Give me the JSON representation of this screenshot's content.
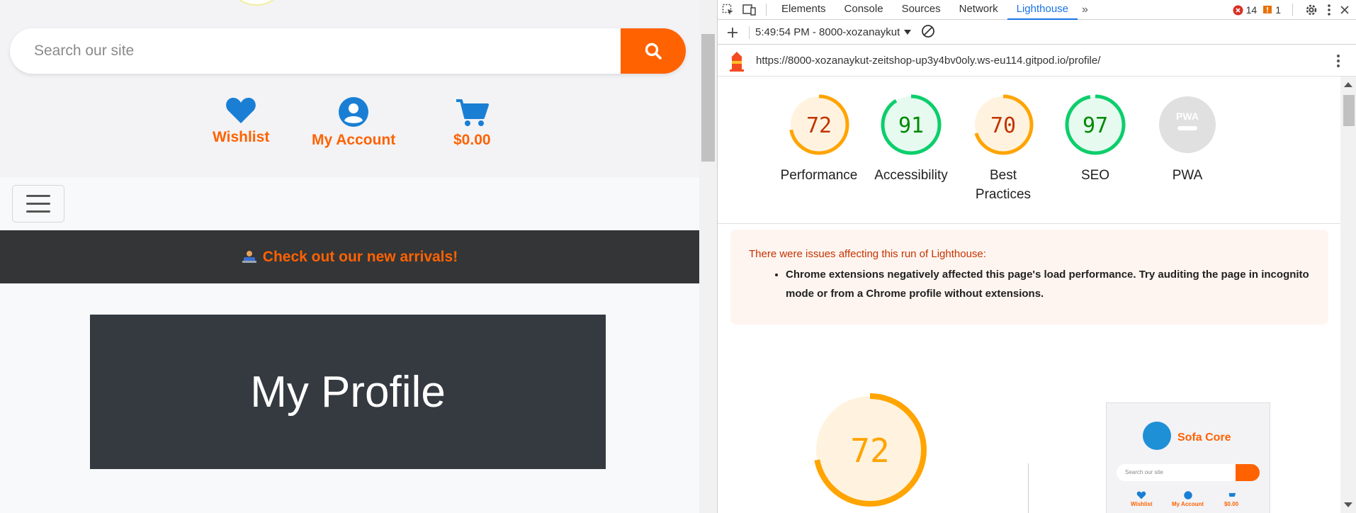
{
  "site": {
    "search": {
      "placeholder": "Search our site"
    },
    "header_links": {
      "wishlist": "Wishlist",
      "account": "My Account",
      "cart": "$0.00"
    },
    "promo": {
      "text": "Check out our new arrivals!"
    },
    "hero": {
      "title": "My Profile"
    }
  },
  "devtools": {
    "tabs": [
      "Elements",
      "Console",
      "Sources",
      "Network",
      "Lighthouse"
    ],
    "active_tab": "Lighthouse",
    "errors_count": "14",
    "warnings_count": "1",
    "report_label": "5:49:54 PM - 8000-xozanaykut",
    "url": "https://8000-xozanaykut-zeitshop-up3y4bv0oly.ws-eu114.gitpod.io/profile/"
  },
  "lighthouse": {
    "categories": [
      {
        "name": "Performance",
        "score": "72",
        "fraction": 0.72,
        "color": "#ffa400",
        "bg": "#fff3e0",
        "text_color": "#c33300"
      },
      {
        "name": "Accessibility",
        "score": "91",
        "fraction": 0.91,
        "color": "#0cce6b",
        "bg": "#e6faf0",
        "text_color": "#008800"
      },
      {
        "name": "Best Practices",
        "score": "70",
        "fraction": 0.7,
        "color": "#ffa400",
        "bg": "#fff3e0",
        "text_color": "#c33300"
      },
      {
        "name": "SEO",
        "score": "97",
        "fraction": 0.97,
        "color": "#0cce6b",
        "bg": "#e6faf0",
        "text_color": "#008800"
      },
      {
        "name": "PWA",
        "score": "PWA",
        "fraction": 0,
        "color": "#bdbdbd",
        "bg": "#e0e0e0",
        "text_color": "#ffffff"
      }
    ],
    "warning_title": "There were issues affecting this run of Lighthouse:",
    "warning_item": "Chrome extensions negatively affected this page's load performance. Try auditing the page in incognito mode or from a Chrome profile without extensions.",
    "big_score": "72",
    "big_fraction": 0.72,
    "thumbnail": {
      "brand": "Sofa Core",
      "search_placeholder": "Search our site",
      "wishlist": "Wishlist",
      "account": "My Account",
      "cart": "$0.00"
    }
  },
  "colors": {
    "accent": "#ff6200",
    "icon_blue": "#1a7fd4",
    "devtools_active": "#1a73e8"
  }
}
